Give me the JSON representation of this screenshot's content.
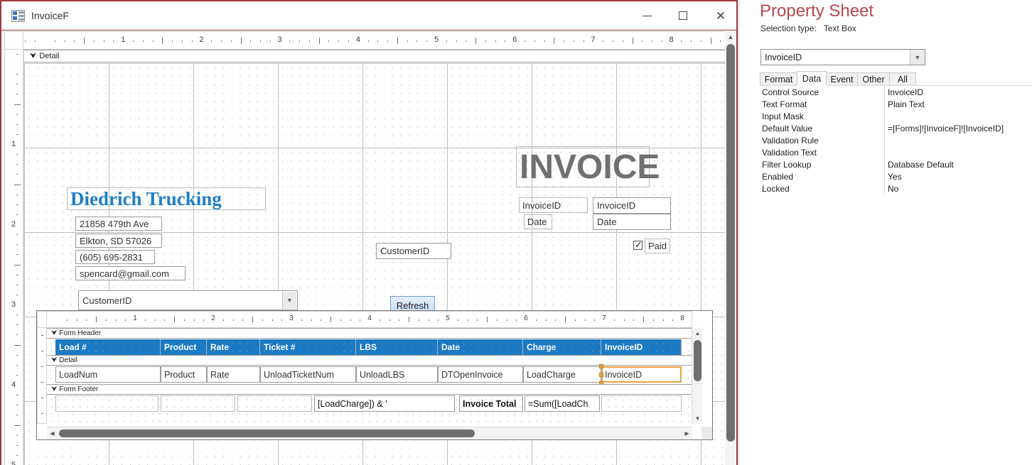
{
  "window": {
    "title": "InvoiceF",
    "icon": "form-design-icon",
    "minimize_label": "–",
    "maximize_label": "□",
    "close_label": "✕"
  },
  "rulers": {
    "horizontal_ticks": [
      1,
      2,
      3,
      4,
      5,
      6,
      7,
      8
    ],
    "vertical_ticks": [
      1,
      2,
      3,
      4,
      5
    ],
    "subform_horizontal_ticks": [
      1,
      2,
      3,
      4,
      5,
      6,
      7,
      8
    ]
  },
  "form": {
    "detail_section_label": "Detail",
    "company_title": "Diedrich Trucking",
    "invoice_title": "INVOICE",
    "address": [
      "21858 479th Ave",
      "Elkton, SD 57026",
      "(605) 695-2831",
      "spencard@gmail.com"
    ],
    "invoiceid_label": "InvoiceID",
    "invoiceid_control": "InvoiceID",
    "date_label": "Date",
    "date_control": "Date",
    "paid_label": "Paid",
    "paid_checked": true,
    "customerid_textbox": "CustomerID",
    "customerid_combo": "CustomerID",
    "refresh_button": "Refresh",
    "colors": {
      "company_title": "#1f7fc4",
      "invoice_title": "#707070",
      "subform_header_bg": "#1b7ac4",
      "selection_handle": "#e8a33d",
      "window_border": "#a4373a"
    }
  },
  "subform": {
    "sections": {
      "form_header": "Form Header",
      "detail": "Detail",
      "form_footer": "Form Footer"
    },
    "header_labels": [
      "Load #",
      "Product",
      "Rate",
      "Ticket #",
      "LBS",
      "Date",
      "Charge",
      "InvoiceID"
    ],
    "detail_controls": [
      "LoadNum",
      "Product",
      "Rate",
      "UnloadTicketNum",
      "UnloadLBS",
      "DTOpenInvoice",
      "LoadCharge",
      "InvoiceID"
    ],
    "selected_control": "InvoiceID",
    "footer": {
      "expression_left": "[LoadCharge]) & '",
      "total_label": "Invoice Total",
      "total_expression": "=Sum([LoadCh"
    }
  },
  "property_sheet": {
    "title": "Property Sheet",
    "selection_type_label": "Selection type:",
    "selection_type_value": "Text Box",
    "selected_object": "InvoiceID",
    "tabs": [
      {
        "label": "Format",
        "active": false
      },
      {
        "label": "Data",
        "active": true
      },
      {
        "label": "Event",
        "active": false
      },
      {
        "label": "Other",
        "active": false
      },
      {
        "label": "All",
        "active": false
      }
    ],
    "rows": [
      {
        "name": "Control Source",
        "value": "InvoiceID"
      },
      {
        "name": "Text Format",
        "value": "Plain Text"
      },
      {
        "name": "Input Mask",
        "value": ""
      },
      {
        "name": "Default Value",
        "value": "=[Forms]![InvoiceF]![InvoiceID]"
      },
      {
        "name": "Validation Rule",
        "value": ""
      },
      {
        "name": "Validation Text",
        "value": ""
      },
      {
        "name": "Filter Lookup",
        "value": "Database Default"
      },
      {
        "name": "Enabled",
        "value": "Yes"
      },
      {
        "name": "Locked",
        "value": "No"
      }
    ]
  },
  "icons": {
    "chevron_down": "▼",
    "arrow_up": "▲",
    "arrow_down": "▼",
    "arrow_left": "◀",
    "arrow_right": "▶",
    "section_caret": "⮟",
    "checkmark": "✓"
  }
}
